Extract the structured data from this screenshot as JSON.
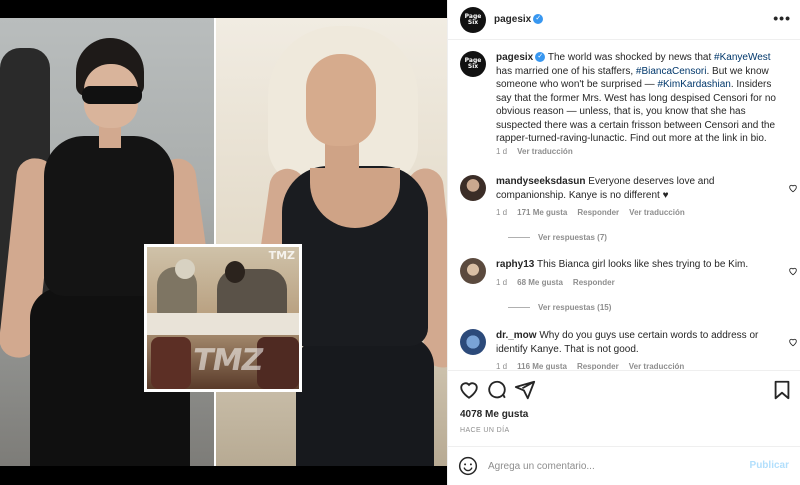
{
  "post": {
    "account": "pagesix",
    "verified": true,
    "avatar_text": "Page Six",
    "more_label": "•••"
  },
  "caption": {
    "username": "pagesix",
    "part1": " The world was shocked by news that ",
    "tag1": "#KanyeWest",
    "part2": " has married one of his staffers, ",
    "tag2": "#BiancaCensori",
    "part3": ". But we know someone who won't be surprised — ",
    "tag3": "#KimKardashian",
    "part4": ". Insiders say that the former Mrs. West has long despised Censori for no obvious reason — unless, that is, you know that she has suspected there was a certain frisson between Censori and the rapper-turned-raving-lunactic. Find out more at the link in bio.",
    "age": "1 d",
    "see_translation": "Ver traducción"
  },
  "comments": [
    {
      "username": "mandyseeksdasun",
      "text": "Everyone deserves love and companionship. Kanye is no different ♥",
      "age": "1 d",
      "likes": "171 Me gusta",
      "reply": "Responder",
      "see_translation": "Ver traducción",
      "view_replies": "Ver respuestas (7)"
    },
    {
      "username": "raphy13",
      "text": "This Bianca girl looks like shes trying to be Kim.",
      "age": "1 d",
      "likes": "68 Me gusta",
      "reply": "Responder",
      "view_replies": "Ver respuestas (15)"
    },
    {
      "username": "dr._mow",
      "text": "Why do you guys use certain words to address or identify Kanye. That is not good.",
      "age": "1 d",
      "likes": "116 Me gusta",
      "reply": "Responder",
      "see_translation": "Ver traducción"
    }
  ],
  "stats": {
    "likes": "4078 Me gusta",
    "time": "HACE UN DÍA"
  },
  "composer": {
    "placeholder": "Agrega un comentario...",
    "publish": "Publicar"
  },
  "media": {
    "watermark": "TMZ",
    "watermark_small": "TMZ"
  },
  "colors": {
    "verified": "#3897f0",
    "hashtag": "#00376b",
    "muted": "#8e8e8e",
    "publish_disabled": "#b2dffc"
  }
}
